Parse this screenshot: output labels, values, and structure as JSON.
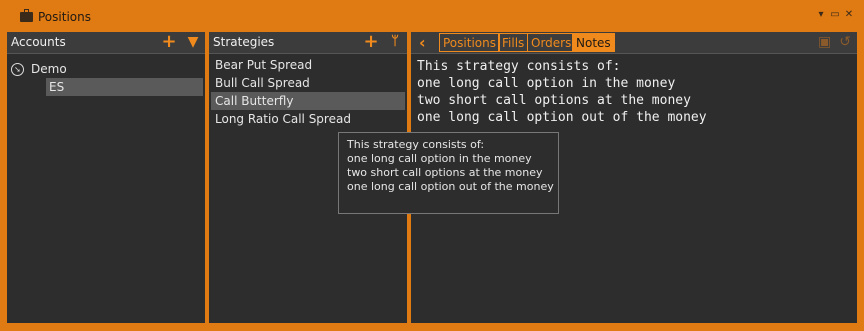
{
  "window": {
    "title": "Positions"
  },
  "accounts": {
    "header": "Accounts",
    "root": "Demo",
    "child": "ES"
  },
  "strategies": {
    "header": "Strategies",
    "items": [
      "Bear Put Spread",
      "Bull Call Spread",
      "Call Butterfly",
      "Long Ratio Call Spread"
    ],
    "selected_index": 2
  },
  "details": {
    "tabs": [
      "Positions",
      "Fills",
      "Orders",
      "Notes"
    ],
    "active_tab": "Notes",
    "notes_text": "This strategy consists of:\none long call option in the money\ntwo short call options at the money\none long call option out of the money"
  },
  "tooltip": {
    "lines": [
      "This strategy consists of:",
      "one long call option in the money",
      "two short call options at the money",
      "one long call option out of the money"
    ]
  },
  "colors": {
    "accent": "#f08a1c",
    "panel": "#2d2d2d",
    "header": "#3c3c3c",
    "selection": "#5a5a5a"
  },
  "icons": {
    "title": "briefcase-icon",
    "add": "plus-icon",
    "filter": "filter-icon",
    "branch": "branch-icon",
    "back": "chevron-left-icon",
    "save": "save-icon",
    "undo": "undo-icon"
  }
}
